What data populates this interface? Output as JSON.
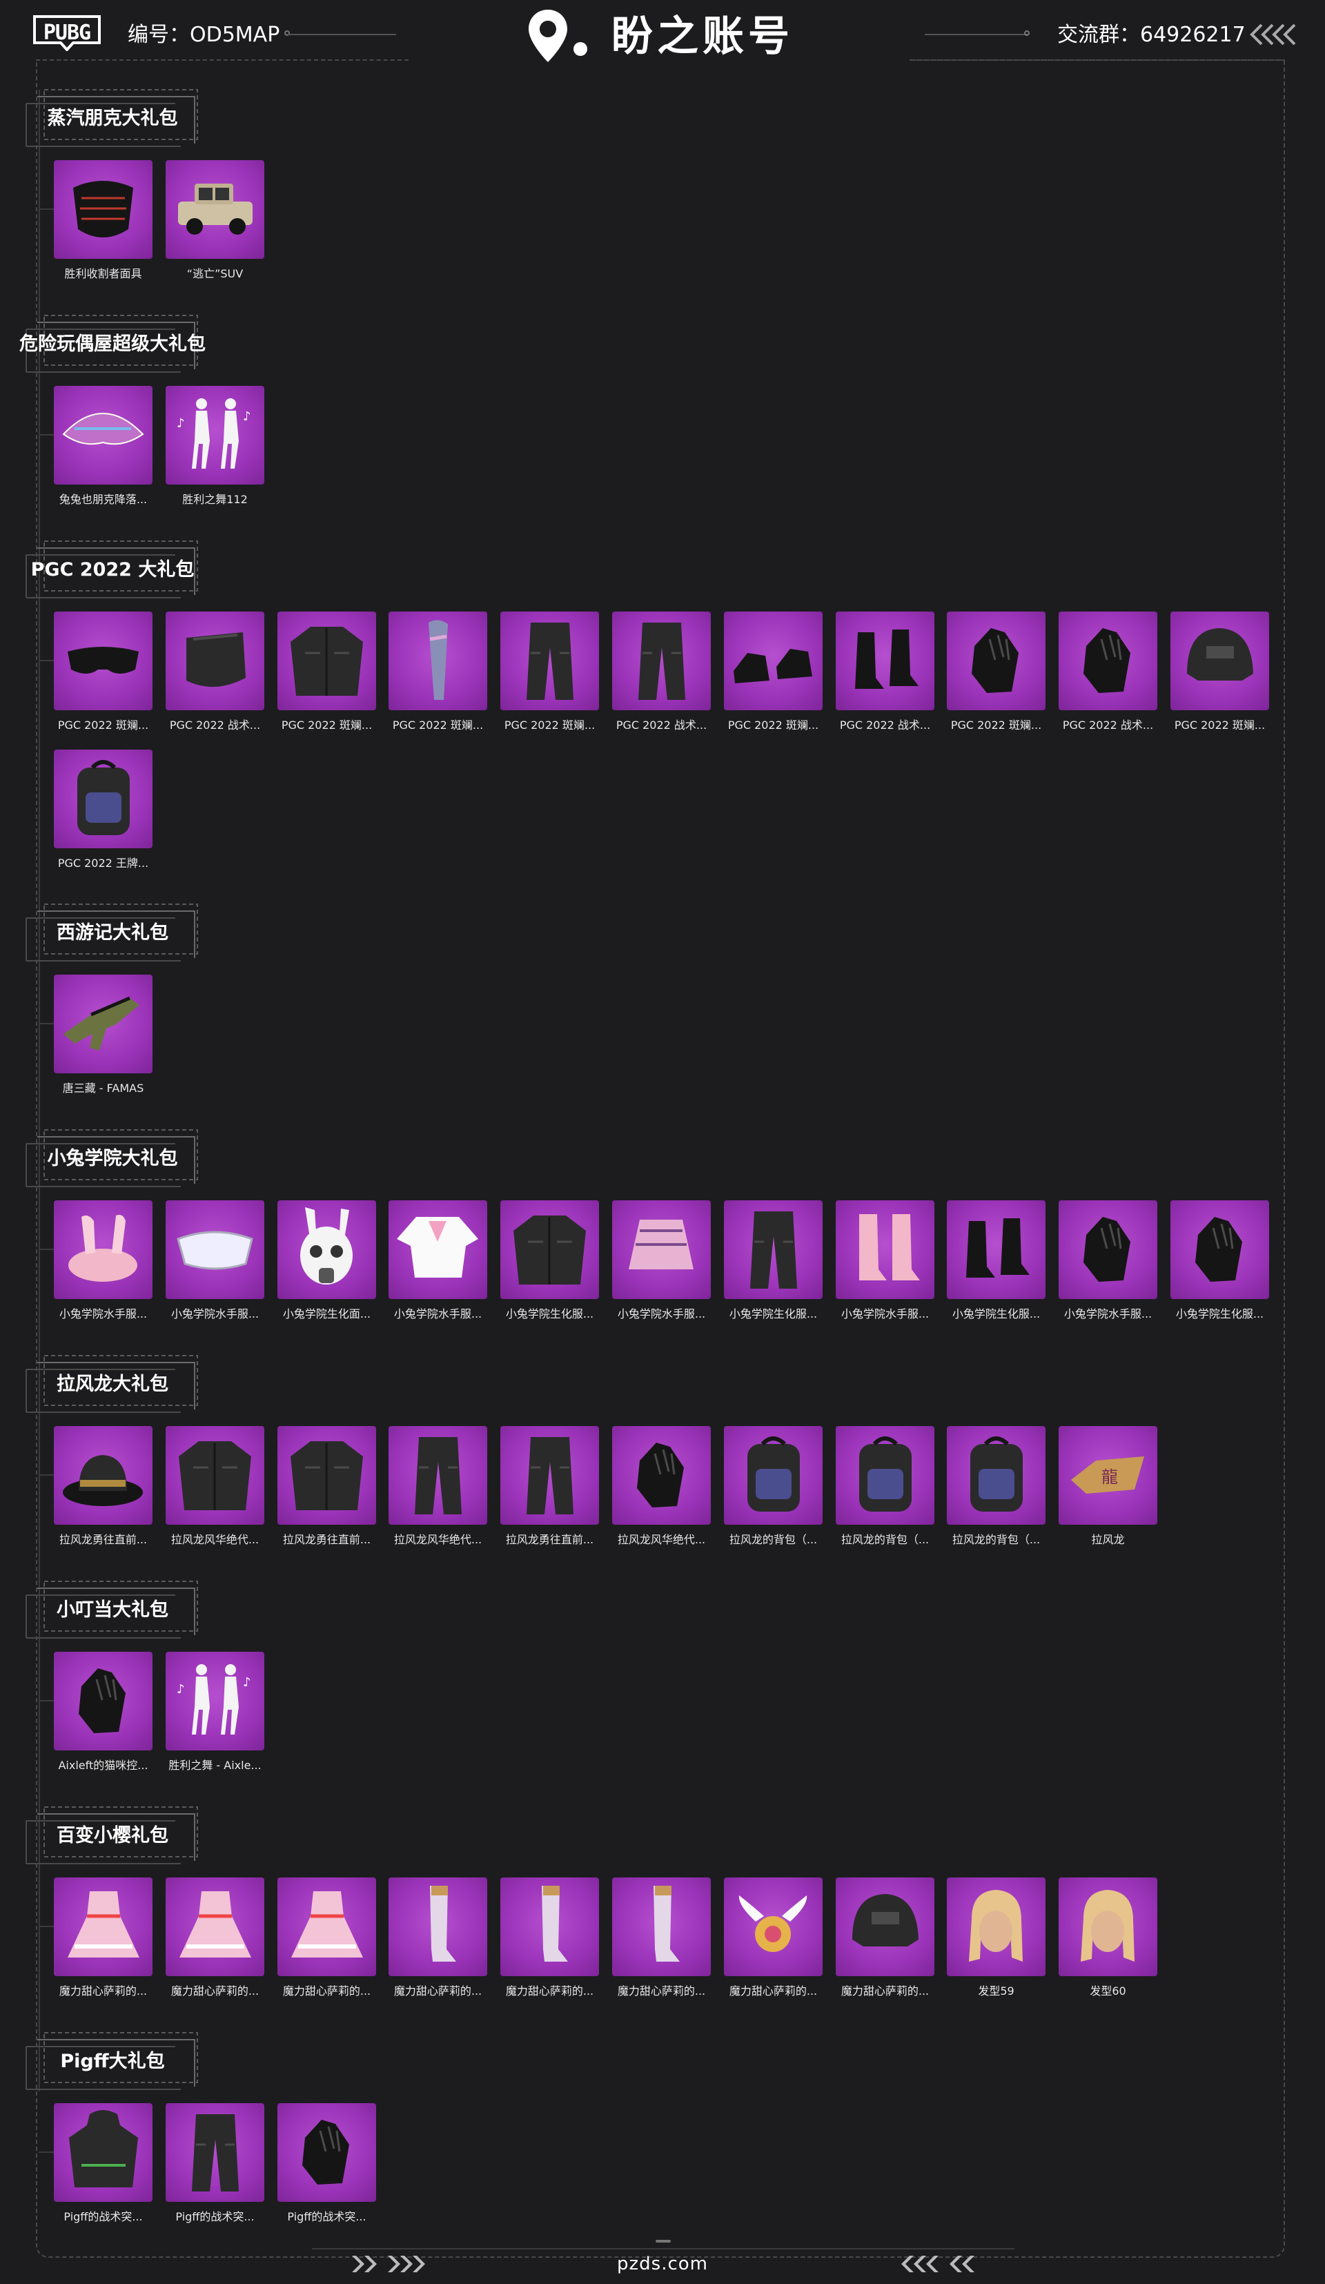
{
  "header": {
    "logo_text": "PUBG",
    "serial": "编号：OD5MAP",
    "brand_name": "盼之账号",
    "group": "交流群：64926217"
  },
  "footer": {
    "site": "pzds.com"
  },
  "colors": {
    "background": "#1c1c1e",
    "tile": "#9a33b8",
    "line": "#3a3a3a"
  },
  "sections": [
    {
      "title": "蒸汽朋克大礼包",
      "items": [
        {
          "label": "胜利收割者面具",
          "icon": "mask-icon"
        },
        {
          "label": "“逃亡”SUV",
          "icon": "car-icon"
        }
      ]
    },
    {
      "title": "危险玩偶屋超级大礼包",
      "items": [
        {
          "label": "兔兔也朋克降落...",
          "icon": "parachute-icon"
        },
        {
          "label": "胜利之舞112",
          "icon": "dance-icon"
        }
      ]
    },
    {
      "title": "PGC 2022 大礼包",
      "items": [
        {
          "label": "PGC 2022 斑斓...",
          "icon": "goggles-icon"
        },
        {
          "label": "PGC 2022 战术...",
          "icon": "face-mask-icon"
        },
        {
          "label": "PGC 2022 斑斓...",
          "icon": "jacket-icon"
        },
        {
          "label": "PGC 2022 斑斓...",
          "icon": "scarf-icon"
        },
        {
          "label": "PGC 2022 斑斓...",
          "icon": "pants-icon"
        },
        {
          "label": "PGC 2022 战术...",
          "icon": "pants-icon"
        },
        {
          "label": "PGC 2022 斑斓...",
          "icon": "shoes-icon"
        },
        {
          "label": "PGC 2022 战术...",
          "icon": "boots-icon"
        },
        {
          "label": "PGC 2022 斑斓...",
          "icon": "gloves-icon"
        },
        {
          "label": "PGC 2022 战术...",
          "icon": "gloves-icon"
        },
        {
          "label": "PGC 2022 斑斓...",
          "icon": "helmet-icon"
        },
        {
          "label": "PGC 2022 王牌...",
          "icon": "backpack-icon"
        }
      ]
    },
    {
      "title": "西游记大礼包",
      "items": [
        {
          "label": "唐三藏 - FAMAS",
          "icon": "rifle-icon"
        }
      ]
    },
    {
      "title": "小兔学院大礼包",
      "items": [
        {
          "label": "小兔学院水手服...",
          "icon": "bunny-hat-icon"
        },
        {
          "label": "小兔学院水手服...",
          "icon": "visor-icon"
        },
        {
          "label": "小兔学院生化面...",
          "icon": "gas-mask-icon"
        },
        {
          "label": "小兔学院水手服...",
          "icon": "shirt-icon"
        },
        {
          "label": "小兔学院生化服...",
          "icon": "jacket-icon"
        },
        {
          "label": "小兔学院水手服...",
          "icon": "skirt-icon"
        },
        {
          "label": "小兔学院生化服...",
          "icon": "pants-icon"
        },
        {
          "label": "小兔学院水手服...",
          "icon": "socks-icon"
        },
        {
          "label": "小兔学院生化服...",
          "icon": "boots-icon"
        },
        {
          "label": "小兔学院水手服...",
          "icon": "gloves-icon"
        },
        {
          "label": "小兔学院生化服...",
          "icon": "gloves-icon"
        }
      ]
    },
    {
      "title": "拉风龙大礼包",
      "items": [
        {
          "label": "拉风龙勇往直前...",
          "icon": "bucket-hat-icon"
        },
        {
          "label": "拉风龙风华绝代...",
          "icon": "jacket-icon"
        },
        {
          "label": "拉风龙勇往直前...",
          "icon": "jacket-icon"
        },
        {
          "label": "拉风龙风华绝代...",
          "icon": "pants-icon"
        },
        {
          "label": "拉风龙勇往直前...",
          "icon": "pants-icon"
        },
        {
          "label": "拉风龙风华绝代...",
          "icon": "gloves-icon"
        },
        {
          "label": "拉风龙的背包（...",
          "icon": "backpack-icon"
        },
        {
          "label": "拉风龙的背包（...",
          "icon": "backpack-icon"
        },
        {
          "label": "拉风龙的背包（...",
          "icon": "backpack-icon"
        },
        {
          "label": "拉风龙",
          "icon": "emblem-icon"
        }
      ]
    },
    {
      "title": "小叮当大礼包",
      "items": [
        {
          "label": "Aixleft的猫咪控...",
          "icon": "gloves-icon"
        },
        {
          "label": "胜利之舞 - Aixle...",
          "icon": "dance-icon"
        }
      ]
    },
    {
      "title": "百变小樱礼包",
      "items": [
        {
          "label": "魔力甜心萨莉的...",
          "icon": "dress-icon"
        },
        {
          "label": "魔力甜心萨莉的...",
          "icon": "dress-icon"
        },
        {
          "label": "魔力甜心萨莉的...",
          "icon": "dress-icon"
        },
        {
          "label": "魔力甜心萨莉的...",
          "icon": "stockings-icon"
        },
        {
          "label": "魔力甜心萨莉的...",
          "icon": "stockings-icon"
        },
        {
          "label": "魔力甜心萨莉的...",
          "icon": "stockings-icon"
        },
        {
          "label": "魔力甜心萨莉的...",
          "icon": "winged-emblem-icon"
        },
        {
          "label": "魔力甜心萨莉的...",
          "icon": "helmet-icon"
        },
        {
          "label": "发型59",
          "icon": "hairstyle-icon"
        },
        {
          "label": "发型60",
          "icon": "hairstyle-icon"
        }
      ]
    },
    {
      "title": "Pigff大礼包",
      "items": [
        {
          "label": "Pigff的战术突...",
          "icon": "hoodie-icon"
        },
        {
          "label": "Pigff的战术突...",
          "icon": "pants-icon"
        },
        {
          "label": "Pigff的战术突...",
          "icon": "gloves-icon"
        }
      ]
    }
  ]
}
